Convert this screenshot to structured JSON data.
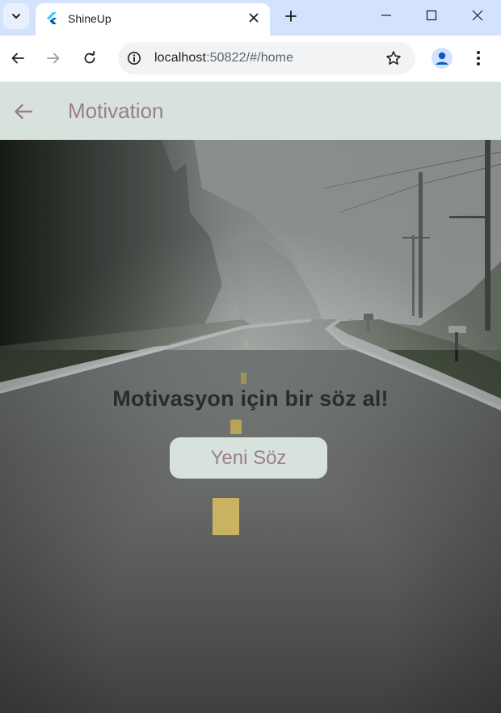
{
  "browser": {
    "tab_title": "ShineUp",
    "url_host": "localhost",
    "url_rest": ":50822/#/home"
  },
  "icons": {
    "tab_search": "chevron-down-icon",
    "favicon": "flutter-logo-icon",
    "tab_close": "close-icon",
    "new_tab": "plus-icon",
    "minimize": "minimize-icon",
    "maximize": "maximize-icon",
    "window_close": "close-icon",
    "back": "arrow-left-icon",
    "forward": "arrow-right-icon",
    "reload": "reload-icon",
    "site_info": "info-icon",
    "bookmark": "star-icon",
    "profile": "person-icon",
    "menu": "more-vertical-icon",
    "app_back": "arrow-left-icon"
  },
  "app": {
    "title": "Motivation",
    "prompt": "Motivasyon için bir söz al!",
    "button_label": "Yeni Söz"
  },
  "colors": {
    "tabstrip": "#d3e3fd",
    "appbar": "#d8e2dd",
    "accent_text": "#9a7f87",
    "prompt_text": "#2b2b2b"
  }
}
